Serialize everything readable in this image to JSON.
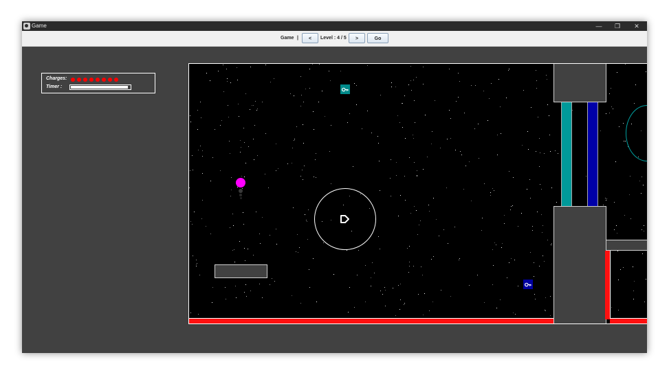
{
  "window": {
    "title": "Game"
  },
  "titlebar": {
    "minimize": "—",
    "restore": "❐",
    "close": "✕"
  },
  "toolbar": {
    "game_label": "Game",
    "separator": "|",
    "prev_label": "<",
    "level_text": "Level : 4 / 5",
    "next_label": ">",
    "go_label": "Go"
  },
  "hud": {
    "charges_label": "Charges:",
    "charges_count": 8,
    "timer_label": "Timer :",
    "timer_fraction": 0.97
  },
  "colors": {
    "background": "#414141",
    "arena": "#000000",
    "player": "#ff00ff",
    "charge": "#ff0000",
    "teal_key": "#008b8b",
    "blue_key": "#0000a0",
    "teal_gate": "#009a9a",
    "blue_gate": "#0000a8",
    "wall_red": "#ff1010"
  },
  "icons": {
    "key": "key-icon",
    "player": "player-ball",
    "goal": "goal-ring"
  }
}
